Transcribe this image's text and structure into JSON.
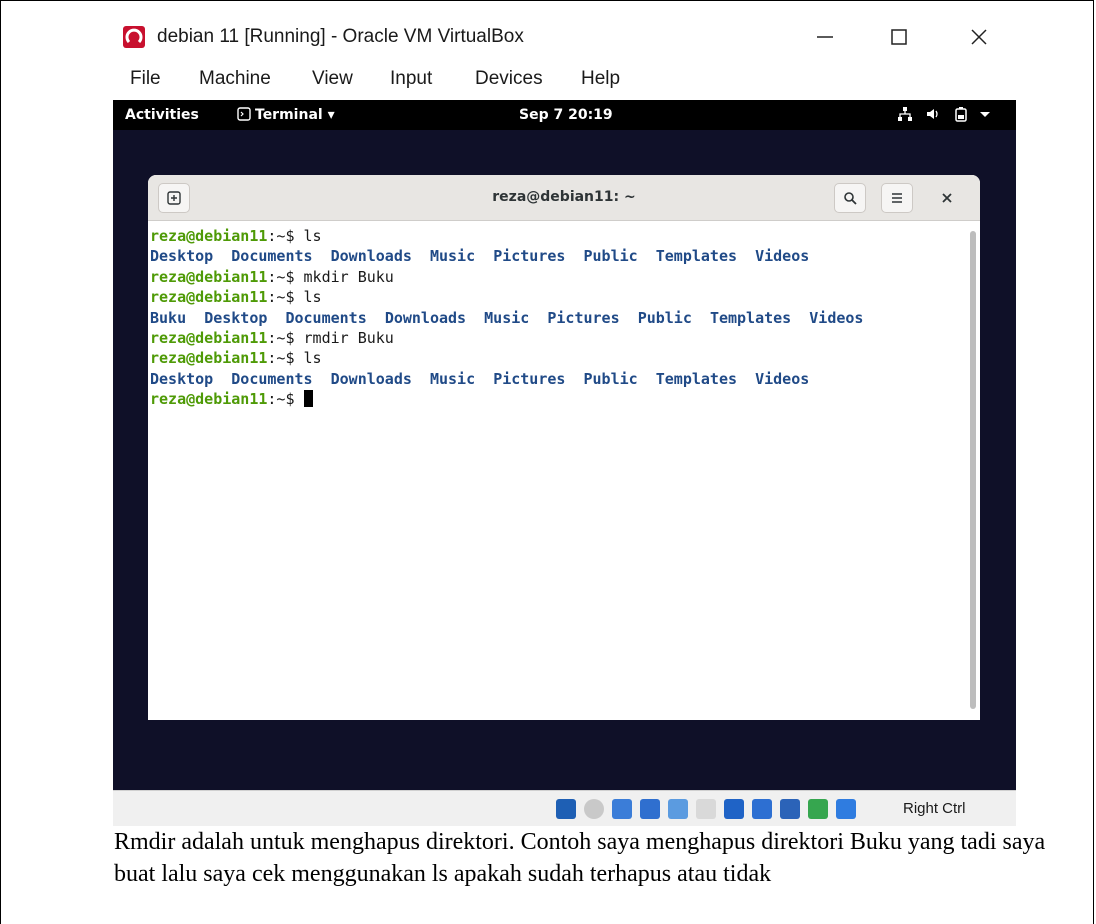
{
  "window": {
    "title": "debian 11 [Running] - Oracle VM VirtualBox",
    "minimize_label": "—",
    "maximize_label": "☐",
    "close_label": "✕"
  },
  "menubar": {
    "items": [
      {
        "label": "File"
      },
      {
        "label": "Machine"
      },
      {
        "label": "View"
      },
      {
        "label": "Input"
      },
      {
        "label": "Devices"
      },
      {
        "label": "Help"
      }
    ]
  },
  "gnome": {
    "activities": "Activities",
    "app_menu": "Terminal ▾",
    "clock": "Sep 7  20:19"
  },
  "terminal": {
    "title": "reza@debian11: ~",
    "prompt": "reza@debian11",
    "prompt_suffix": ":~$ ",
    "lines": [
      {
        "type": "cmd",
        "text": "ls"
      },
      {
        "type": "out",
        "dirs": [
          "Desktop",
          "Documents",
          "Downloads",
          "Music",
          "Pictures",
          "Public",
          "Templates",
          "Videos"
        ]
      },
      {
        "type": "cmd",
        "text": "mkdir Buku"
      },
      {
        "type": "cmd",
        "text": "ls"
      },
      {
        "type": "out",
        "dirs": [
          "Buku",
          "Desktop",
          "Documents",
          "Downloads",
          "Music",
          "Pictures",
          "Public",
          "Templates",
          "Videos"
        ]
      },
      {
        "type": "cmd",
        "text": "rmdir Buku"
      },
      {
        "type": "cmd",
        "text": "ls"
      },
      {
        "type": "out",
        "dirs": [
          "Desktop",
          "Documents",
          "Downloads",
          "Music",
          "Pictures",
          "Public",
          "Templates",
          "Videos"
        ]
      },
      {
        "type": "cmd",
        "text": ""
      }
    ]
  },
  "statusbar": {
    "host_key": "Right Ctrl",
    "icon_colors": [
      "#1e5fb4",
      "#c9c9c9",
      "#3b7dd8",
      "#2f6fcf",
      "#5b9be0",
      "#d9d9d9",
      "#1f63c6",
      "#2d6fd2",
      "#2b63b8",
      "#36a64f",
      "#2f7ce0"
    ]
  },
  "caption": {
    "text": "Rmdir adalah untuk menghapus direktori. Contoh saya menghapus direktori Buku yang tadi saya buat lalu saya cek menggunakan ls apakah sudah terhapus atau tidak"
  }
}
